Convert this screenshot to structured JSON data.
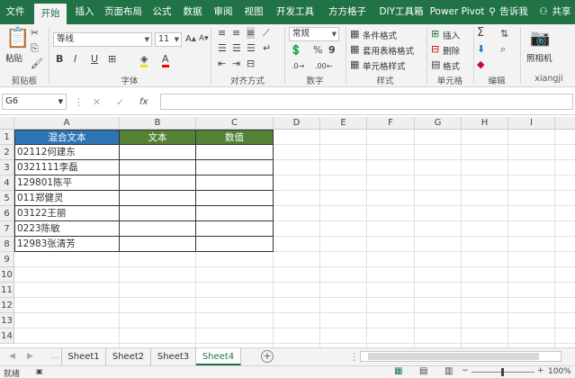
{
  "ribbon_tabs": [
    "文件",
    "开始",
    "插入",
    "页面布局",
    "公式",
    "数据",
    "审阅",
    "视图",
    "开发工具",
    "方方格子",
    "DIY工具箱",
    "Power Pivot"
  ],
  "active_tab": "开始",
  "tell_me": "告诉我",
  "share": "共享",
  "ribbon": {
    "paste": "粘贴",
    "font_name": "等线",
    "font_size": "11",
    "bold": "B",
    "italic": "I",
    "underline": "U",
    "number_format": "常规",
    "percent": "%",
    "comma": "9",
    "cond_format": "条件格式",
    "table_format": "套用表格格式",
    "cell_style": "单元格样式",
    "insert": "插入",
    "delete": "删除",
    "format": "格式",
    "camera": "照相机",
    "user": "xiangji",
    "groups": {
      "clipboard": "剪贴板",
      "font": "字体",
      "align": "对齐方式",
      "number": "数字",
      "styles": "样式",
      "cells": "单元格",
      "editing": "编辑"
    }
  },
  "namebox": "G6",
  "fx": "fx",
  "columns": [
    "A",
    "B",
    "C",
    "D",
    "E",
    "F",
    "G",
    "H",
    "I"
  ],
  "rows": [
    "1",
    "2",
    "3",
    "4",
    "5",
    "6",
    "7",
    "8",
    "9",
    "10",
    "11",
    "12",
    "13",
    "14"
  ],
  "table": {
    "headers": [
      "混合文本",
      "文本",
      "数值"
    ],
    "data": [
      "02112何建东",
      "0321111李磊",
      "129801陈平",
      "011郑健灵",
      "03122王丽",
      "0223陈敏",
      "12983张清芳"
    ]
  },
  "sheets": [
    "Sheet1",
    "Sheet2",
    "Sheet3",
    "Sheet4"
  ],
  "active_sheet": "Sheet4",
  "status": "就绪",
  "zoom": "100%",
  "colors": {
    "header_blue": "#2e75b6",
    "header_green": "#548235",
    "excel_green": "#217346"
  }
}
